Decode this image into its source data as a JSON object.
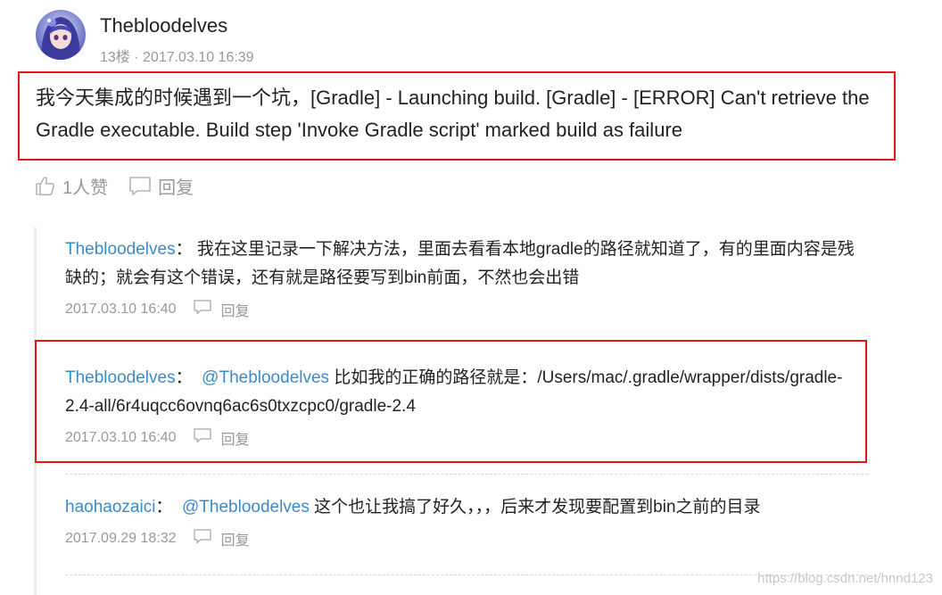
{
  "comment": {
    "username": "Thebloodelves",
    "floor_time": "13楼 · 2017.03.10 16:39",
    "text": "我今天集成的时候遇到一个坑，[Gradle] - Launching build. [Gradle] - [ERROR] Can't retrieve the Gradle executable. Build step 'Invoke Gradle script' marked build as failure",
    "like_label": "1人赞",
    "reply_label": "回复"
  },
  "replies": [
    {
      "author": "Thebloodelves",
      "separator": "：",
      "mention": "",
      "text": " 我在这里记录一下解决方法，里面去看看本地gradle的路径就知道了，有的里面内容是残缺的；就会有这个错误，还有就是路径要写到bin前面，不然也会出错",
      "time": "2017.03.10 16:40",
      "reply_label": "回复"
    },
    {
      "author": "Thebloodelves",
      "separator": "：",
      "mention": "@Thebloodelves",
      "text": " 比如我的正确的路径就是：/Users/mac/.gradle/wrapper/dists/gradle-2.4-all/6r4uqcc6ovnq6ac6s0txzcpc0/gradle-2.4",
      "time": "2017.03.10 16:40",
      "reply_label": "回复"
    },
    {
      "author": "haohaozaici",
      "separator": "：",
      "mention": "@Thebloodelves",
      "text": " 这个也让我搞了好久，，，后来才发现要配置到bin之前的目录",
      "time": "2017.09.29 18:32",
      "reply_label": "回复"
    }
  ],
  "watermark": "https://blog.csdn.net/hnnd123",
  "colors": {
    "link_blue": "#3b8bc8",
    "highlight_red": "#e5161b",
    "meta_gray": "#999999"
  },
  "icons": [
    "like-icon",
    "comment-icon"
  ]
}
